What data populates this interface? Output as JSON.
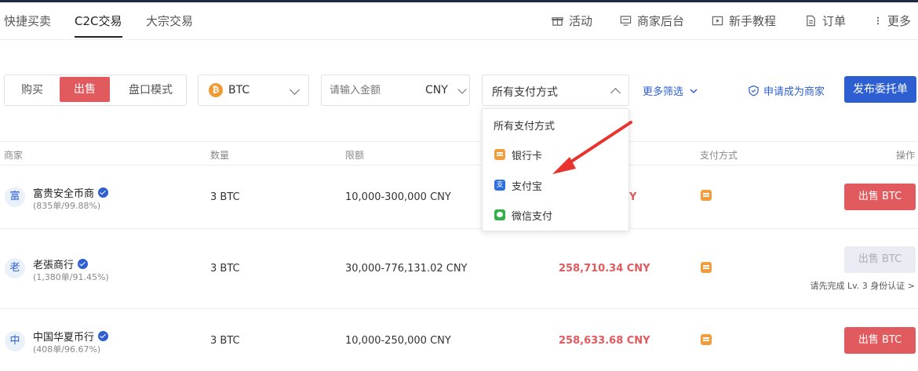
{
  "nav": {
    "tabs": [
      {
        "label": "快捷买卖"
      },
      {
        "label": "C2C交易"
      },
      {
        "label": "大宗交易"
      }
    ],
    "right": [
      {
        "label": "活动",
        "icon": "gift-icon"
      },
      {
        "label": "商家后台",
        "icon": "dashboard-icon"
      },
      {
        "label": "新手教程",
        "icon": "video-icon"
      },
      {
        "label": "订单",
        "icon": "document-icon"
      },
      {
        "label": "更多",
        "icon": "more-icon"
      }
    ]
  },
  "filters": {
    "mode_tabs": [
      {
        "label": "购买"
      },
      {
        "label": "出售"
      },
      {
        "label": "盘口模式"
      }
    ],
    "coin": "BTC",
    "amount_placeholder": "请输入金额",
    "currency": "CNY",
    "payment": "所有支付方式",
    "more_filters": "更多筛选",
    "apply_merchant": "申请成为商家",
    "publish": "发布委托单"
  },
  "table": {
    "headers": {
      "merchant": "商家",
      "quantity": "数量",
      "limit": "限额",
      "payment": "支付方式",
      "action": "操作"
    },
    "rows": [
      {
        "avatar": "富",
        "name": "富贵安全币商",
        "stats": "(835单/99.88%)",
        "quantity": "3 BTC",
        "limit": "10,000-300,000 CNY",
        "price": "Y",
        "action": "出售 BTC",
        "note": ""
      },
      {
        "avatar": "老",
        "name": "老張商行",
        "stats": "(1,380单/91.45%)",
        "quantity": "3 BTC",
        "limit": "30,000-776,131.02 CNY",
        "price": "258,710.34 CNY",
        "action": "出售 BTC",
        "note": "请先完成 Lv. 3 身份认证 >"
      },
      {
        "avatar": "中",
        "name": "中国华夏币行",
        "stats": "(408单/96.67%)",
        "quantity": "3 BTC",
        "limit": "10,000-250,000 CNY",
        "price": "258,633.68 CNY",
        "action": "出售 BTC",
        "note": ""
      }
    ]
  },
  "dropdown": {
    "items": [
      {
        "label": "所有支付方式",
        "icon": ""
      },
      {
        "label": "银行卡",
        "icon": "bank-card-icon"
      },
      {
        "label": "支付宝",
        "icon": "alipay-icon"
      },
      {
        "label": "微信支付",
        "icon": "wechat-pay-icon"
      }
    ]
  },
  "colors": {
    "accent_red": "#e05a5e",
    "accent_blue": "#2d5fd3",
    "annotation_arrow": "#e8332f"
  }
}
